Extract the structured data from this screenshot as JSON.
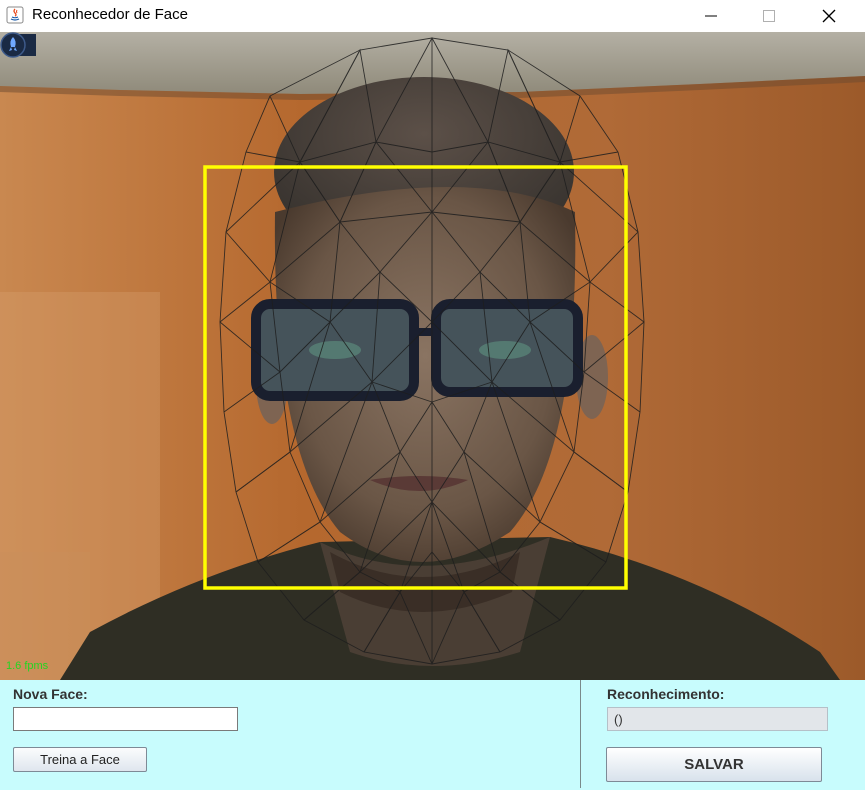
{
  "window": {
    "title": "Reconhecedor de Face",
    "app_icon": "java-icon",
    "minimize_icon": "minimize-icon",
    "maximize_icon": "maximize-icon",
    "close_icon": "close-icon"
  },
  "camera": {
    "fps_label": "1.6 fpms",
    "detection_box_color": "#ffff00",
    "mesh_color": "#1e1e1e",
    "tray_icon": "rocket-icon"
  },
  "form": {
    "nova_face_label": "Nova Face:",
    "nova_face_value": "",
    "treina_button": "Treina a Face",
    "reconhecimento_label": "Reconhecimento:",
    "reconhecimento_value": "()",
    "salvar_button": "SALVAR"
  },
  "colors": {
    "panel_background": "#c8fcfd",
    "fps_text": "#22d622"
  }
}
